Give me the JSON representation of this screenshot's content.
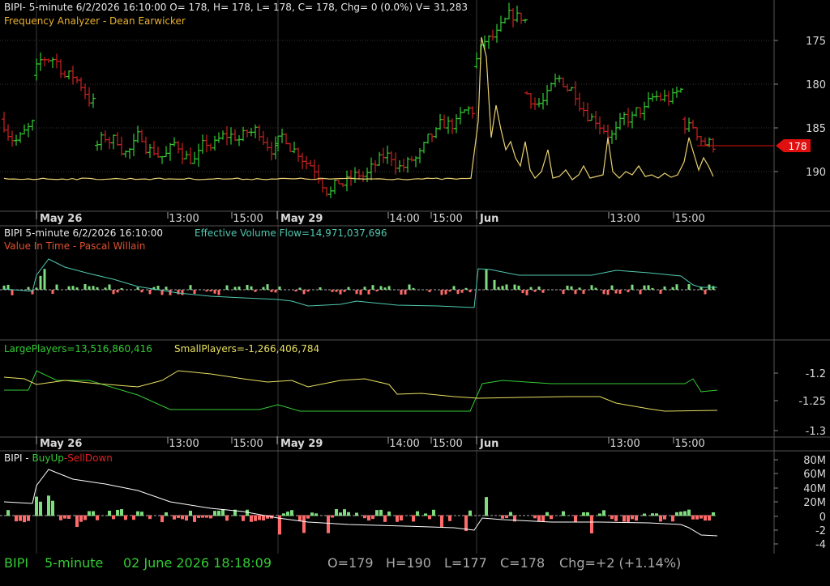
{
  "colors": {
    "background": "#000000",
    "up": "#33cc33",
    "down": "#cc2222",
    "price_line": "#e8d070",
    "axis_text": "#d8d8d8",
    "grid": "#333333",
    "volume_flow": "#4fc9b0",
    "large_players": "#33cc33",
    "small_players": "#e8e060",
    "white_line": "#ffffff",
    "title_yellow": "#e8b030",
    "title_orange": "#e05030",
    "status_green": "#33cc33",
    "status_gray": "#a8a8a8",
    "price_tag": "#e01010"
  },
  "pane1": {
    "header": "BIPI- 5-minute 6/2/2026 16:10:00 O= 178, H= 178, L= 178, C= 178, Chg= 0 (0.0%) V= 31,283",
    "study": "Frequency Analyzer - Dean Earwicker",
    "y_ticks": [
      "190",
      "185",
      "180",
      "175"
    ],
    "last_price_tag": "178"
  },
  "pane2": {
    "header": "BIPI 5-minute  6/2/2026 16:10:00",
    "flow_label": "Effective Volume Flow=14,971,037,696",
    "study": "Value In Time - Pascal Willain"
  },
  "pane3": {
    "large_label": "LargePlayers=13,516,860,416",
    "small_label": "SmallPlayers=-1,266,406,784",
    "y_ticks": [
      "-1.2",
      "-1.25",
      "-1.3"
    ]
  },
  "pane4": {
    "label_prefix": "BIPI - ",
    "buy_label": "BuyUp",
    "sell_label": "-SellDown",
    "y_ticks": [
      "80M",
      "60M",
      "40M",
      "20M",
      "0",
      "-2",
      "-4"
    ]
  },
  "time_axis": {
    "day_labels": [
      "May 26",
      "May 29",
      "Jun"
    ],
    "time_labels": [
      "13:00",
      "15:00",
      "14:00",
      "15:00",
      "13:00",
      "15:00"
    ]
  },
  "status_bar": {
    "symbol": "BIPI",
    "interval": "5-minute",
    "datetime": "02 June 2026 18:18:09",
    "open": "O=179",
    "high": "H=190",
    "low": "L=177",
    "close": "C=178",
    "change": "Chg=+2 (+1.14%)"
  }
}
